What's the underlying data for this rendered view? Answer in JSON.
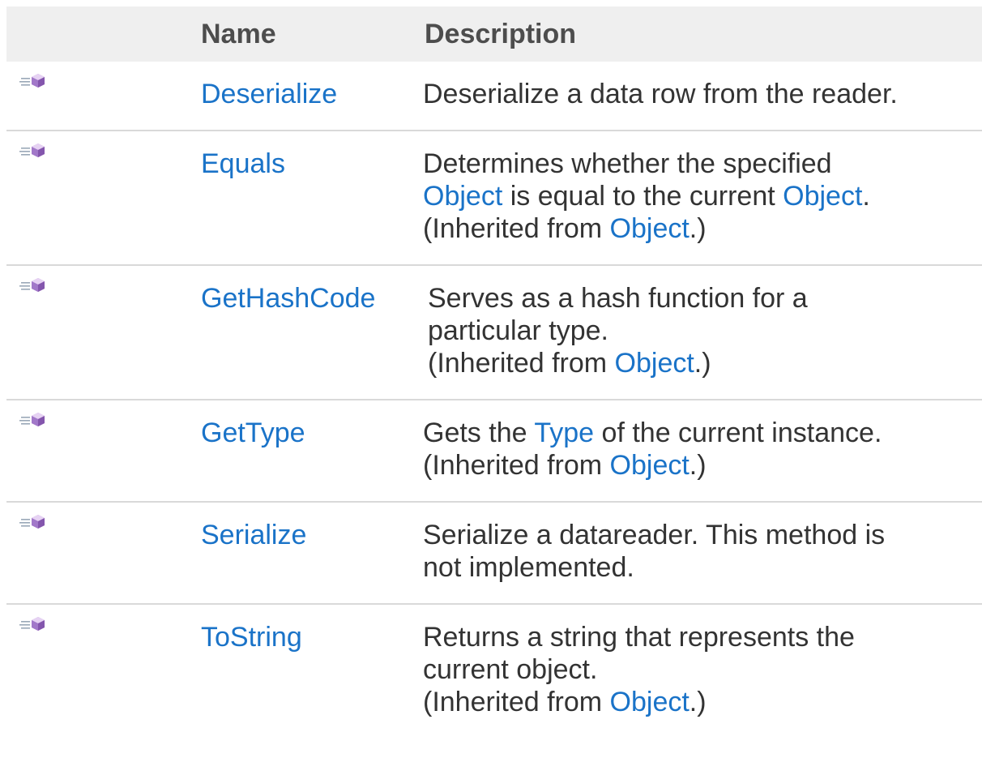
{
  "table": {
    "headers": {
      "name": "Name",
      "description": "Description"
    },
    "inherited_prefix": "(Inherited from ",
    "inherited_suffix": ".)",
    "rows": [
      {
        "icon": "public-method-icon",
        "name": "Deserialize",
        "desc": "Deserialize a data row from the reader."
      },
      {
        "icon": "public-method-icon",
        "name": "Equals",
        "desc_a": "Determines whether the specified",
        "link_a": "Object",
        "desc_b": "is equal to the current",
        "link_b": "Object",
        "desc_c": ".",
        "inherited_link": "Object"
      },
      {
        "icon": "public-method-icon",
        "name": "GetHashCode",
        "desc_line1": "Serves as a hash function for a",
        "desc_line2": "particular type.",
        "inherited_link": "Object"
      },
      {
        "icon": "public-method-icon",
        "name": "GetType",
        "desc_a": "Gets the",
        "link_a": "Type",
        "desc_b": "of the current instance.",
        "inherited_link": "Object"
      },
      {
        "icon": "public-method-icon",
        "name": "Serialize",
        "desc_line1": "Serialize a datareader. This method is",
        "desc_line2": "not implemented."
      },
      {
        "icon": "public-method-icon",
        "name": "ToString",
        "desc_line1": "Returns a string that represents the",
        "desc_line2": "current object.",
        "inherited_link": "Object"
      }
    ]
  },
  "colors": {
    "link": "#1a73c8",
    "header_bg": "#efefef",
    "divider": "#d9d9d9",
    "text": "#333333"
  }
}
